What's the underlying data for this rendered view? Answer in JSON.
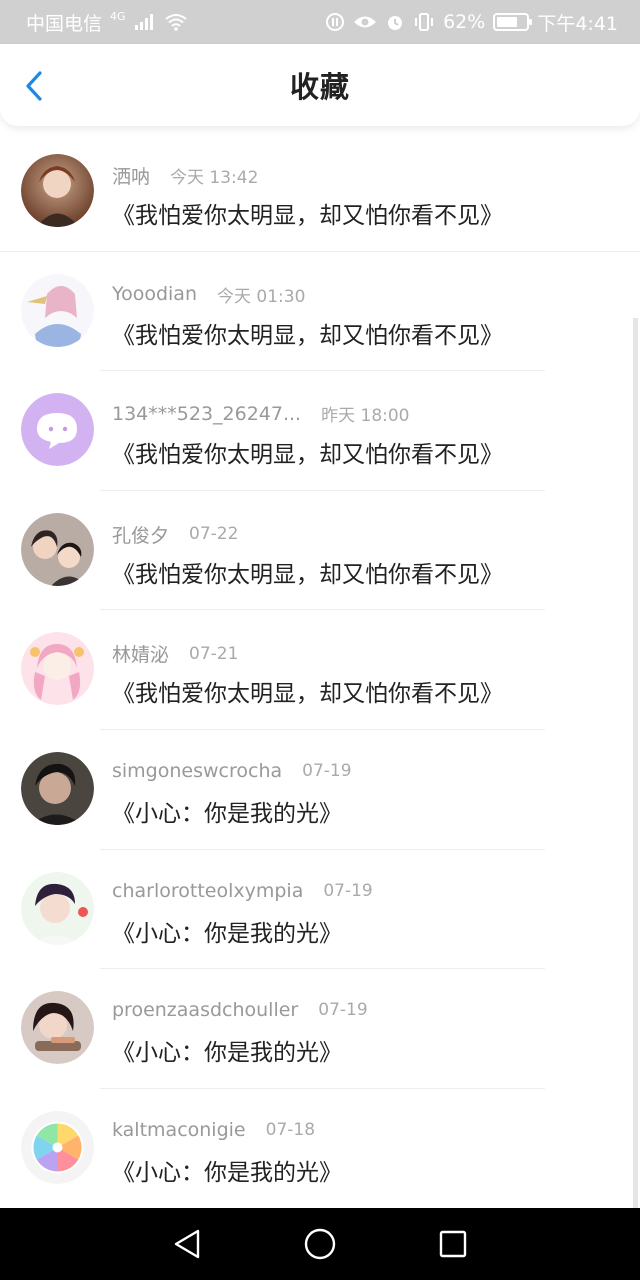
{
  "status_bar": {
    "carrier": "中国电信",
    "network": "4G",
    "battery": "62%",
    "time": "下午4:41"
  },
  "header": {
    "title": "收藏"
  },
  "colors": {
    "accent": "#1e88e5",
    "name_gray": "#999999",
    "content": "#222222"
  },
  "items": [
    {
      "name": "洒呐",
      "time": "今天 13:42",
      "content": "《我怕爱你太明显，却又怕你看不见》",
      "avatar": {
        "bg1": "#c9a48a",
        "bg2": "#6b3f2a"
      }
    },
    {
      "name": "Yooodian",
      "time": "今天 01:30",
      "content": "《我怕爱你太明显，却又怕你看不见》",
      "avatar": {
        "bg1": "#f3d7e2",
        "bg2": "#8aa6d8"
      }
    },
    {
      "name": "134***523_26247...",
      "time": "昨天 18:00",
      "content": "《我怕爱你太明显，却又怕你看不见》",
      "avatar": {
        "bg1": "#d7b7f0",
        "bg2": "#c9a2ef"
      }
    },
    {
      "name": "孔俊夕",
      "time": "07-22",
      "content": "《我怕爱你太明显，却又怕你看不见》",
      "avatar": {
        "bg1": "#b8a9a0",
        "bg2": "#3d3030"
      }
    },
    {
      "name": "林婧泌",
      "time": "07-21",
      "content": "《我怕爱你太明显，却又怕你看不见》",
      "avatar": {
        "bg1": "#fbd3df",
        "bg2": "#e6a3bd"
      }
    },
    {
      "name": "simgoneswcrocha",
      "time": "07-19",
      "content": "《小心：你是我的光》",
      "avatar": {
        "bg1": "#6b6258",
        "bg2": "#1c1a1a"
      }
    },
    {
      "name": "charlorotteolxympia",
      "time": "07-19",
      "content": "《小心：你是我的光》",
      "avatar": {
        "bg1": "#e9f3ea",
        "bg2": "#3b2a4a"
      }
    },
    {
      "name": "proenzaasdchouller",
      "time": "07-19",
      "content": "《小心：你是我的光》",
      "avatar": {
        "bg1": "#d8c7c2",
        "bg2": "#2a1b1b"
      }
    },
    {
      "name": "kaltmaconigie",
      "time": "07-18",
      "content": "《小心：你是我的光》",
      "avatar": {
        "bg1": "#fff0a8",
        "bg2": "#8fe0b8"
      }
    }
  ],
  "nav": {
    "back": "back-triangle",
    "home": "home-circle",
    "recents": "recents-square"
  }
}
